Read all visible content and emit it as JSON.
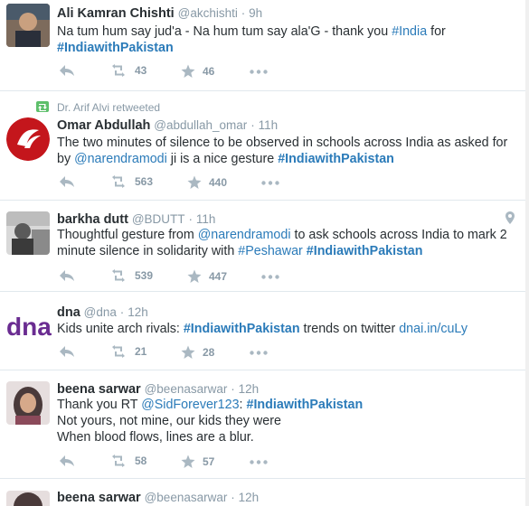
{
  "tweets": [
    {
      "name": "Ali Kamran Chishti",
      "handle": "@akchishti",
      "time": "9h",
      "line1_pre": "Na tum hum say jud'a - Na hum tum say ala'G - thank you ",
      "line1_link": "#India",
      "line1_post": " for",
      "line2_hash": "#IndiawithPakistan",
      "retweets": "43",
      "favorites": "46"
    },
    {
      "retweeted_by": "Dr. Arif Alvi retweeted",
      "name": "Omar Abdullah",
      "handle": "@abdullah_omar",
      "time": "11h",
      "line1": "The two minutes of silence to be observed in schools across India as asked for",
      "line2_pre": "by ",
      "line2_link": "@narendramodi",
      "line2_mid": " ji is a nice gesture ",
      "line2_hash": "#IndiawithPakistan",
      "retweets": "563",
      "favorites": "440"
    },
    {
      "name": "barkha dutt",
      "handle": "@BDUTT",
      "time": "11h",
      "line1_pre": "Thoughtful gesture from ",
      "line1_link": "@narendramodi",
      "line1_post": " to ask schools across India to mark 2",
      "line2_pre": "minute silence in solidarity with ",
      "line2_link": "#Peshawar",
      "line2_space": " ",
      "line2_hash": "#IndiawithPakistan",
      "retweets": "539",
      "favorites": "447",
      "icon_geo": "location-pin-icon"
    },
    {
      "name": "dna",
      "handle": "@dna",
      "time": "12h",
      "line1_pre": "Kids unite arch rivals: ",
      "line1_hash": "#IndiawithPakistan",
      "line1_mid": " trends on twitter ",
      "line1_link": "dnai.in/cuLy",
      "logo_text": "dna",
      "retweets": "21",
      "favorites": "28"
    },
    {
      "name": "beena sarwar",
      "handle": "@beenasarwar",
      "time": "12h",
      "line1_pre": "Thank you RT ",
      "line1_link": "@SidForever123",
      "line1_colon": ": ",
      "line1_hash": "#IndiawithPakistan",
      "line2": "Not yours, not mine, our kids they were",
      "line3": "When blood flows, lines are a blur.",
      "retweets": "58",
      "favorites": "57"
    },
    {
      "name": "beena sarwar",
      "handle": "@beenasarwar",
      "time": "12h"
    }
  ],
  "separator": "·",
  "colors": {
    "link": "#2b7bb9",
    "muted": "#8899a6",
    "retweet_green": "#5dbf6a",
    "dna_purple": "#6a2c91"
  }
}
